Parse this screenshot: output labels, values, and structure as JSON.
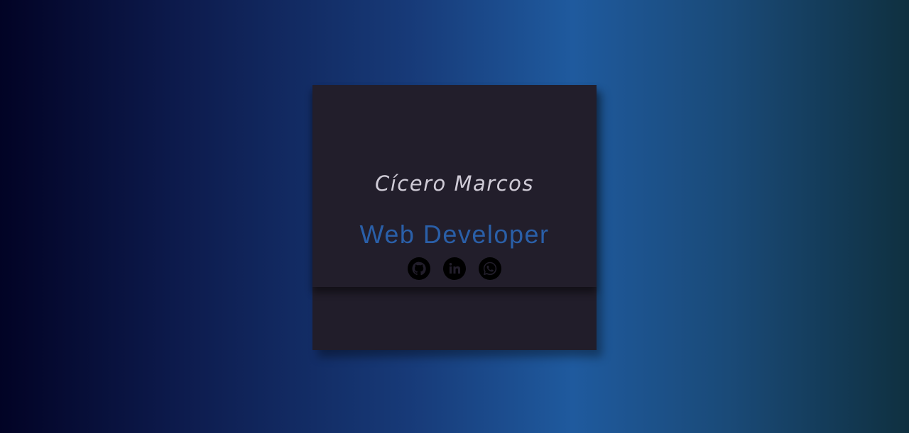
{
  "profile": {
    "name": "Cícero Marcos",
    "role": "Web Developer"
  },
  "socials": [
    {
      "icon": "github-icon"
    },
    {
      "icon": "linkedin-icon"
    },
    {
      "icon": "whatsapp-icon"
    }
  ],
  "colors": {
    "card": "#211d2a",
    "name_text": "#cfcbd6",
    "role_text": "#2a5fa8",
    "icons": "#000000"
  }
}
